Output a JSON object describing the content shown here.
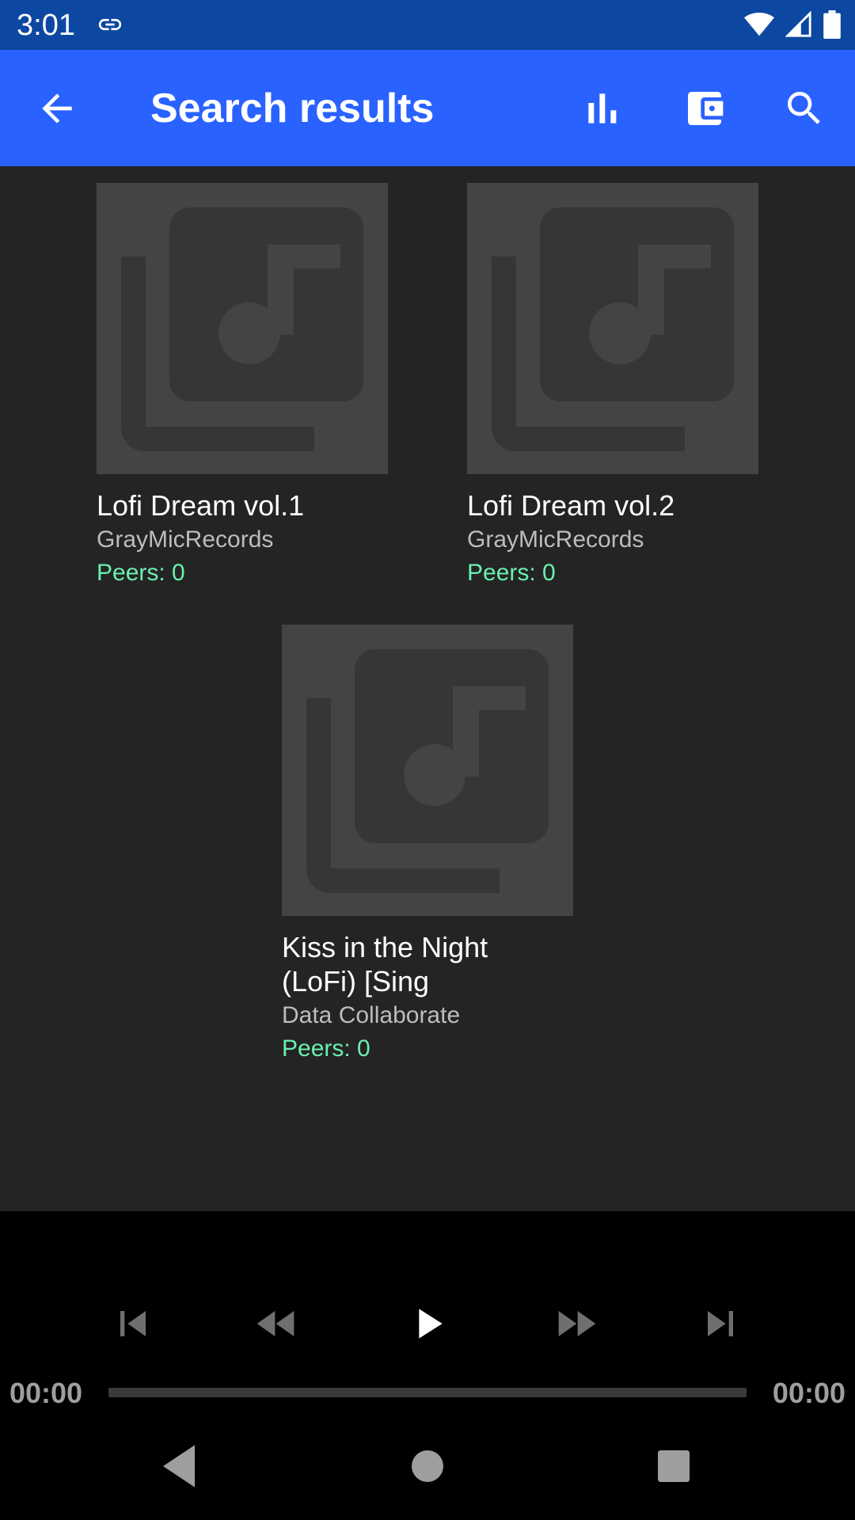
{
  "status_bar": {
    "time": "3:01",
    "icons": [
      "link-icon",
      "wifi-icon",
      "signal-icon",
      "battery-icon"
    ]
  },
  "app_bar": {
    "title": "Search results",
    "actions": [
      "back-arrow-icon",
      "equalizer-icon",
      "wallet-icon",
      "search-icon"
    ]
  },
  "results": [
    {
      "title": "Lofi Dream vol.1",
      "artist": "GrayMicRecords",
      "peers": "Peers: 0",
      "art_icon": "album-placeholder-icon"
    },
    {
      "title": "Lofi Dream vol.2",
      "artist": "GrayMicRecords",
      "peers": "Peers: 0",
      "art_icon": "album-placeholder-icon"
    },
    {
      "title_line1": "Kiss in the Night",
      "title_line2": "(LoFi) [Sing",
      "artist": "Data Collaborate",
      "peers": "Peers: 0",
      "art_icon": "album-placeholder-icon"
    }
  ],
  "player": {
    "elapsed": "00:00",
    "duration": "00:00",
    "progress": 0,
    "controls": [
      "skip-previous-icon",
      "rewind-icon",
      "play-icon",
      "fast-forward-icon",
      "skip-next-icon"
    ]
  },
  "nav_bar": {
    "buttons": [
      "nav-back-icon",
      "nav-home-icon",
      "nav-recents-icon"
    ]
  },
  "colors": {
    "status_bar": "#0c47a1",
    "app_bar": "#2962ff",
    "background": "#242424",
    "art_placeholder": "#444444",
    "peers_text": "#69f0ae",
    "artist_text": "#bdbdbd"
  }
}
